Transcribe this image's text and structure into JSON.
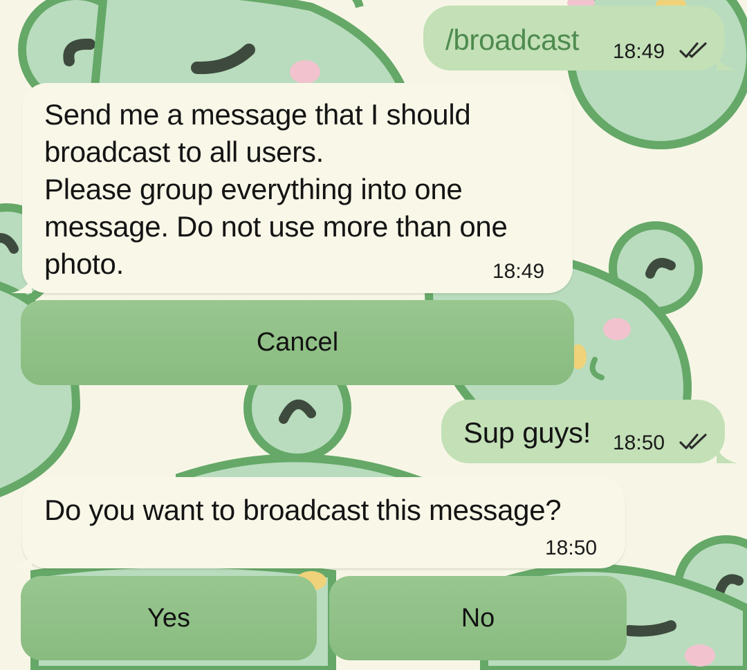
{
  "theme": {
    "background": "#f7f6e6",
    "outgoing_bubble": "#c3e0b7",
    "incoming_bubble": "#f8f7e8",
    "button": "#92c289",
    "frog_body": "#b6dbbd",
    "frog_outline": "#64a767"
  },
  "messages": [
    {
      "direction": "outgoing",
      "text": "/broadcast",
      "time": "18:49",
      "status_icon": "double-check-icon"
    },
    {
      "direction": "incoming",
      "lines": [
        "Send me a message that I should",
        "broadcast to all users.",
        "Please group everything into one",
        "message. Do not use more than one",
        "photo."
      ],
      "time": "18:49"
    },
    {
      "direction": "outgoing",
      "text": "Sup guys!",
      "time": "18:50",
      "status_icon": "double-check-icon"
    },
    {
      "direction": "incoming",
      "text": "Do you want to broadcast this message?",
      "time": "18:50"
    }
  ],
  "keyboards": {
    "first": [
      "Cancel"
    ],
    "second": [
      "Yes",
      "No"
    ]
  }
}
